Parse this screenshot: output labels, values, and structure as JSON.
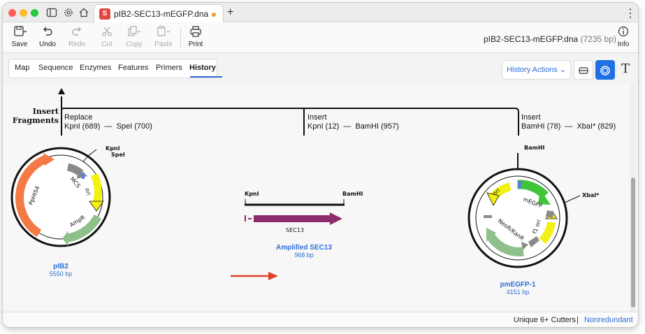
{
  "window": {
    "tab_title": "pIB2-SEC13-mEGFP.dna",
    "tab_logo": "S",
    "new_tab": "+",
    "more_menu": "⋮",
    "traffic_lights": [
      "#ff5f57",
      "#febc2e",
      "#28c840"
    ]
  },
  "toolbar": {
    "save": "Save",
    "undo": "Undo",
    "redo": "Redo",
    "cut": "Cut",
    "copy": "Copy",
    "paste": "Paste",
    "print": "Print",
    "info": "Info",
    "doc_name": "pIB2-SEC13-mEGFP.dna",
    "doc_bp": "(7235 bp)"
  },
  "viewtabs": {
    "items": [
      "Map",
      "Sequence",
      "Enzymes",
      "Features",
      "Primers",
      "History"
    ],
    "active": "History"
  },
  "history_actions": "History Actions ⌄",
  "history": {
    "operation": [
      "Insert",
      "Fragments"
    ],
    "steps": [
      {
        "action": "Replace",
        "detail": "KpnI (689)  —  SpeI (700)"
      },
      {
        "action": "Insert",
        "detail": "KpnI (12)  —  BamHI (957)"
      },
      {
        "action": "Insert",
        "detail": "BamHI (78)  —  XbaI* (829)"
      }
    ],
    "plasmid_1": {
      "name": "pIB2",
      "size": "5550 bp",
      "sites": [
        "KpnI",
        "SpeI"
      ],
      "features": [
        "PpHIS4",
        "AmpR",
        "ori",
        "MCS"
      ]
    },
    "fragment": {
      "name": "Amplified SEC13",
      "size": "968 bp",
      "left_site": "KpnI",
      "right_site": "BamHI",
      "feature": "SEC13"
    },
    "plasmid_2": {
      "name": "pmEGFP-1",
      "size": "4151 bp",
      "sites": [
        "BamHI",
        "XbaI*"
      ],
      "features": [
        "ori",
        "mEGFP",
        "f1 ori",
        "NeoR/KanR"
      ]
    }
  },
  "status": {
    "cutters": "Unique 6+ Cutters",
    "separator": "|",
    "mode": "Nonredundant"
  },
  "colors": {
    "accent": "#2f6fd6",
    "arrow": "#e0402a",
    "feature_orange": "#f47a45",
    "feature_green": "#8fbf8a",
    "feature_yellow": "#f3f014",
    "feature_gray": "#8a8a8a",
    "feature_purple": "#8e2c6e",
    "feature_bright_green": "#3fc43a"
  }
}
